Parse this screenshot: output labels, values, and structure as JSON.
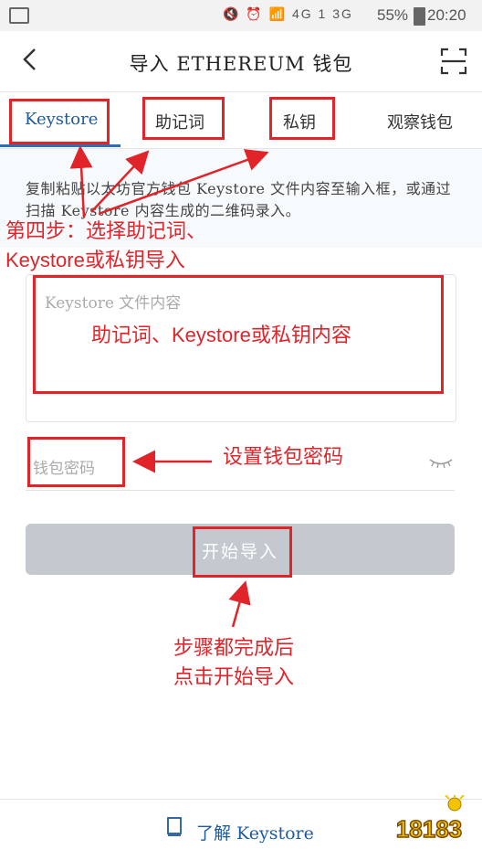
{
  "status_bar": {
    "battery": "55%",
    "time": "20:20",
    "indicators": "4G 1 3G"
  },
  "header": {
    "title": "导入 ETHEREUM 钱包"
  },
  "tabs": [
    {
      "label": "Keystore",
      "active": true
    },
    {
      "label": "助记词",
      "active": false
    },
    {
      "label": "私钥",
      "active": false
    },
    {
      "label": "观察钱包",
      "active": false
    }
  ],
  "description": "复制粘贴以太坊官方钱包 Keystore 文件内容至输入框，或通过扫描 Keystore 内容生成的二维码录入。",
  "keystore_input": {
    "placeholder": "Keystore 文件内容"
  },
  "password_input": {
    "placeholder": "钱包密码"
  },
  "import_button": {
    "label": "开始导入"
  },
  "footer": {
    "link_label": "了解 Keystore"
  },
  "watermark": {
    "text": "18183"
  },
  "annotations": {
    "step4_line1": "第四步：选择助记词、",
    "step4_line2": "Keystore或私钥导入",
    "content_label": "助记词、Keystore或私钥内容",
    "password_label": "设置钱包密码",
    "finish_line1": "步骤都完成后",
    "finish_line2": "点击开始导入"
  },
  "colors": {
    "accent": "#1f5a9a",
    "annotation": "#e0242a",
    "button_disabled": "#c4c8cf"
  }
}
